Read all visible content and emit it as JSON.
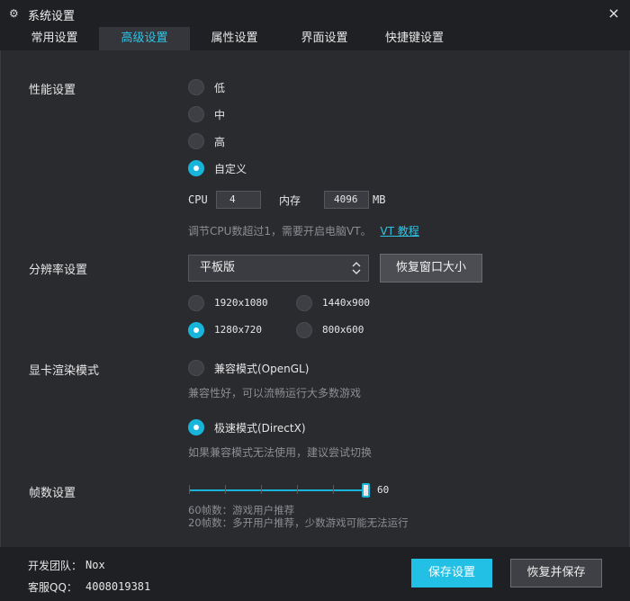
{
  "window": {
    "title": "系统设置",
    "close": "×"
  },
  "tabs": [
    {
      "label": "常用设置"
    },
    {
      "label": "高级设置",
      "active": true
    },
    {
      "label": "属性设置"
    },
    {
      "label": "界面设置"
    },
    {
      "label": "快捷键设置"
    }
  ],
  "performance": {
    "label": "性能设置",
    "options": [
      "低",
      "中",
      "高",
      "自定义"
    ],
    "selected": "自定义",
    "cpu_label": "CPU",
    "cpu_value": "4",
    "memory_label": "内存",
    "memory_value": "4096",
    "memory_unit": "MB",
    "hint": "调节CPU数超过1，需要开启电脑VT。",
    "hint_link": "VT 教程"
  },
  "resolution": {
    "label": "分辨率设置",
    "select_value": "平板版",
    "restore_button": "恢复窗口大小",
    "options": [
      "1920x1080",
      "1440x900",
      "1280x720",
      "800x600"
    ],
    "selected": "1280x720"
  },
  "graphics": {
    "label": "显卡渲染模式",
    "option1": "兼容模式(OpenGL)",
    "option1_hint": "兼容性好，可以流畅运行大多数游戏",
    "option2": "极速模式(DirectX)",
    "option2_hint": "如果兼容模式无法使用，建议尝试切换",
    "selected": "极速模式(DirectX)"
  },
  "fps": {
    "label": "帧数设置",
    "value": "60",
    "hint1": "60帧数：游戏用户推荐",
    "hint2": "20帧数：多开用户推荐，少数游戏可能无法运行"
  },
  "footer": {
    "team_label": "开发团队：",
    "team_value": "Nox",
    "qq_label": "客服QQ：",
    "qq_value": "4008019381",
    "save_button": "保存设置",
    "reset_button": "恢复并保存"
  },
  "colors": {
    "accent": "#18b5da",
    "background": "#2a2b2f",
    "titlebar": "#1f2023"
  }
}
